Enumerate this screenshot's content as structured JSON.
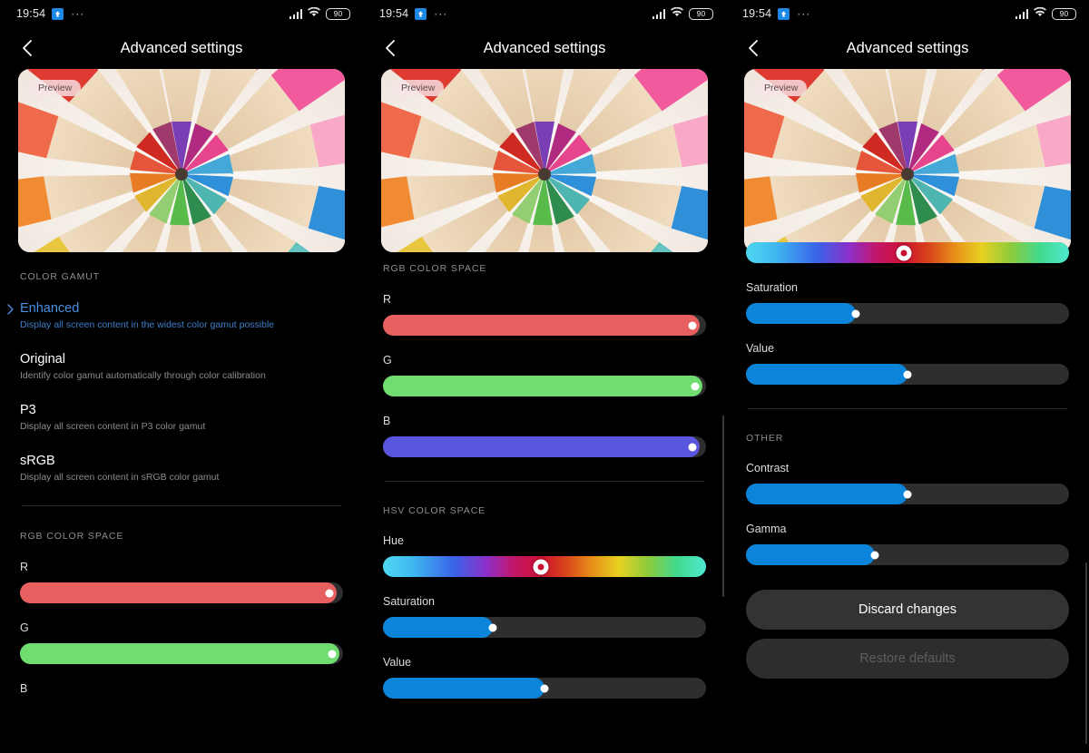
{
  "status_bar": {
    "time": "19:54",
    "badge_icon": "upload-arrow-icon",
    "overflow_dots": "···",
    "battery_level": "90",
    "signal_icon": "cellular-signal-icon",
    "wifi_icon": "wifi-icon"
  },
  "app_bar": {
    "back_icon": "back-chevron-icon",
    "title": "Advanced settings"
  },
  "preview": {
    "badge": "Preview",
    "image_alt": "colored-pencils-radial"
  },
  "sections": {
    "color_gamut": "COLOR GAMUT",
    "rgb_color_space": "RGB COLOR SPACE",
    "hsv_color_space": "HSV COLOR SPACE",
    "other": "OTHER"
  },
  "color_gamut_options": [
    {
      "name": "Enhanced",
      "desc": "Display all screen content in the widest color gamut possible",
      "selected": true
    },
    {
      "name": "Original",
      "desc": "Identify color gamut automatically through color calibration",
      "selected": false
    },
    {
      "name": "P3",
      "desc": "Display all screen content in P3 color gamut",
      "selected": false
    },
    {
      "name": "sRGB",
      "desc": "Display all screen content in sRGB color gamut",
      "selected": false
    }
  ],
  "rgb_sliders": [
    {
      "label": "R",
      "value": 98,
      "color": "#e85f5f"
    },
    {
      "label": "G",
      "value": 99,
      "color": "#6fdd6f"
    },
    {
      "label": "B",
      "value": 98,
      "color": "#5b56e0"
    }
  ],
  "hsv_sliders": {
    "hue": {
      "label": "Hue",
      "value": 49
    },
    "saturation": {
      "label": "Saturation",
      "value": 34
    },
    "value": {
      "label": "Value",
      "value": 50
    }
  },
  "other_sliders": {
    "contrast": {
      "label": "Contrast",
      "value": 50
    },
    "gamma": {
      "label": "Gamma",
      "value": 40
    }
  },
  "buttons": {
    "discard": "Discard changes",
    "restore": "Restore defaults"
  },
  "accent_color": "#0c84d9",
  "selected_color": "#4a8fe0"
}
